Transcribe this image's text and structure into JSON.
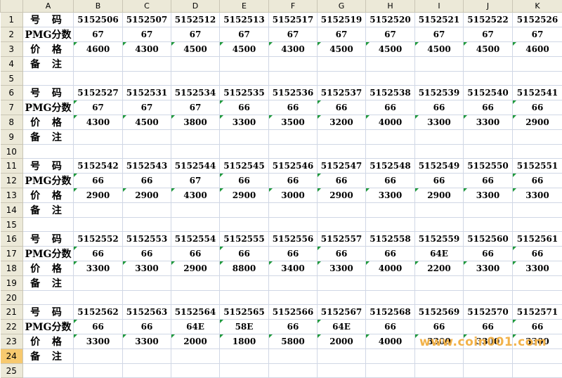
{
  "columns": [
    "A",
    "B",
    "C",
    "D",
    "E",
    "F",
    "G",
    "H",
    "I",
    "J",
    "K"
  ],
  "row_numbers": [
    "1",
    "2",
    "3",
    "4",
    "5",
    "6",
    "7",
    "8",
    "9",
    "10",
    "11",
    "12",
    "13",
    "14",
    "15",
    "16",
    "17",
    "18",
    "19",
    "20",
    "21",
    "22",
    "23",
    "24",
    "25"
  ],
  "labels": {
    "number": "号 码",
    "pmg": "PMG分数",
    "price": "价 格",
    "remark": "备 注"
  },
  "blocks": [
    {
      "numbers": [
        "5152506",
        "5152507",
        "5152512",
        "5152513",
        "5152517",
        "5152519",
        "5152520",
        "5152521",
        "5152522",
        "5152526"
      ],
      "pmg": [
        "67",
        "67",
        "67",
        "67",
        "67",
        "67",
        "67",
        "67",
        "67",
        "67"
      ],
      "price": [
        "4600",
        "4300",
        "4500",
        "4500",
        "4300",
        "4500",
        "4500",
        "4500",
        "4500",
        "4600"
      ]
    },
    {
      "numbers": [
        "5152527",
        "5152531",
        "5152534",
        "5152535",
        "5152536",
        "5152537",
        "5152538",
        "5152539",
        "5152540",
        "5152541"
      ],
      "pmg": [
        "67",
        "67",
        "67",
        "66",
        "66",
        "66",
        "66",
        "66",
        "66",
        "66"
      ],
      "price": [
        "4300",
        "4500",
        "3800",
        "3300",
        "3500",
        "3200",
        "4000",
        "3300",
        "3300",
        "2900"
      ]
    },
    {
      "numbers": [
        "5152542",
        "5152543",
        "5152544",
        "5152545",
        "5152546",
        "5152547",
        "5152548",
        "5152549",
        "5152550",
        "5152551"
      ],
      "pmg": [
        "66",
        "66",
        "67",
        "66",
        "66",
        "66",
        "66",
        "66",
        "66",
        "66"
      ],
      "price": [
        "2900",
        "2900",
        "4300",
        "2900",
        "3000",
        "2900",
        "3300",
        "2900",
        "3300",
        "3300"
      ]
    },
    {
      "numbers": [
        "5152552",
        "5152553",
        "5152554",
        "5152555",
        "5152556",
        "5152557",
        "5152558",
        "5152559",
        "5152560",
        "5152561"
      ],
      "pmg": [
        "66",
        "66",
        "66",
        "66",
        "66",
        "66",
        "66",
        "64E",
        "66",
        "66"
      ],
      "price": [
        "3300",
        "3300",
        "2900",
        "8800",
        "3400",
        "3300",
        "4000",
        "2200",
        "3300",
        "3300"
      ]
    },
    {
      "numbers": [
        "5152562",
        "5152563",
        "5152564",
        "5152565",
        "5152566",
        "5152567",
        "5152568",
        "5152569",
        "5152570",
        "5152571"
      ],
      "pmg": [
        "66",
        "66",
        "64E",
        "58E",
        "66",
        "64E",
        "66",
        "66",
        "66",
        "66"
      ],
      "price": [
        "3300",
        "3300",
        "2000",
        "1800",
        "5800",
        "2000",
        "4000",
        "3300",
        "3300",
        "3300"
      ]
    }
  ],
  "active_row": "24",
  "watermark": "www.coin001.com"
}
